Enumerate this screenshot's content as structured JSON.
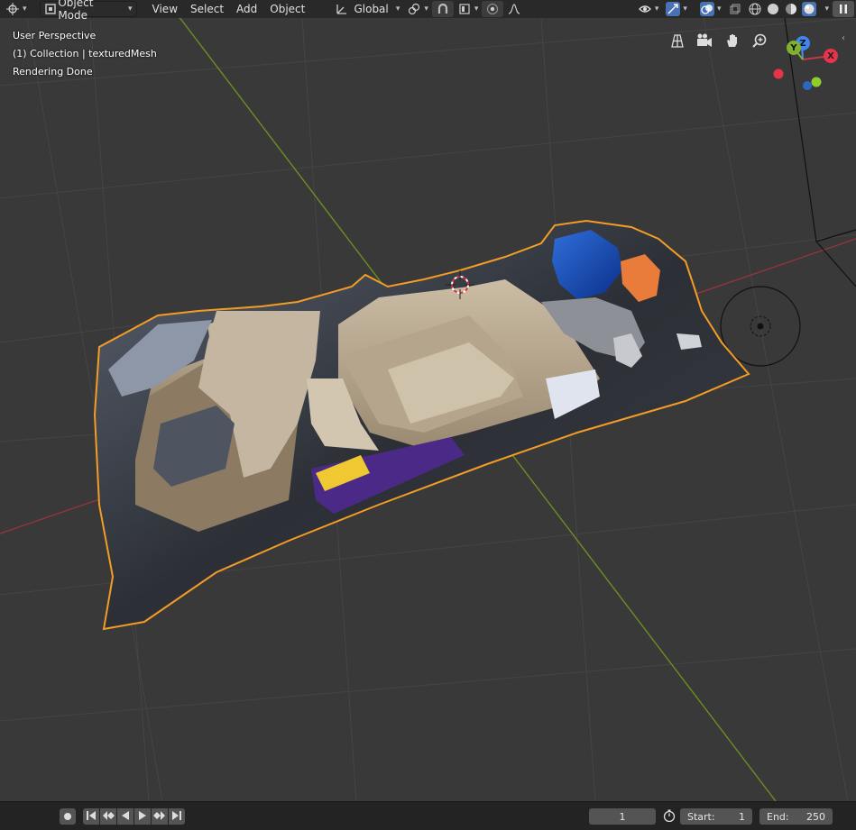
{
  "header": {
    "mode_label": "Object Mode",
    "menus": [
      "View",
      "Select",
      "Add",
      "Object"
    ],
    "orientation_label": "Global"
  },
  "overlay": {
    "perspective": "User Perspective",
    "collection": "(1) Collection | texturedMesh",
    "status": "Rendering Done"
  },
  "gizmo": {
    "x_label": "X",
    "y_label": "Y",
    "z_label": "Z"
  },
  "timeline": {
    "current_frame": "1",
    "start_label": "Start:",
    "start_value": "1",
    "end_label": "End:",
    "end_value": "250"
  },
  "colors": {
    "x_axis": "#d4283f",
    "y_axis": "#8ab82b",
    "z_axis": "#3a7bd5",
    "selection": "#f0a030",
    "active_button": "#4772b3"
  }
}
